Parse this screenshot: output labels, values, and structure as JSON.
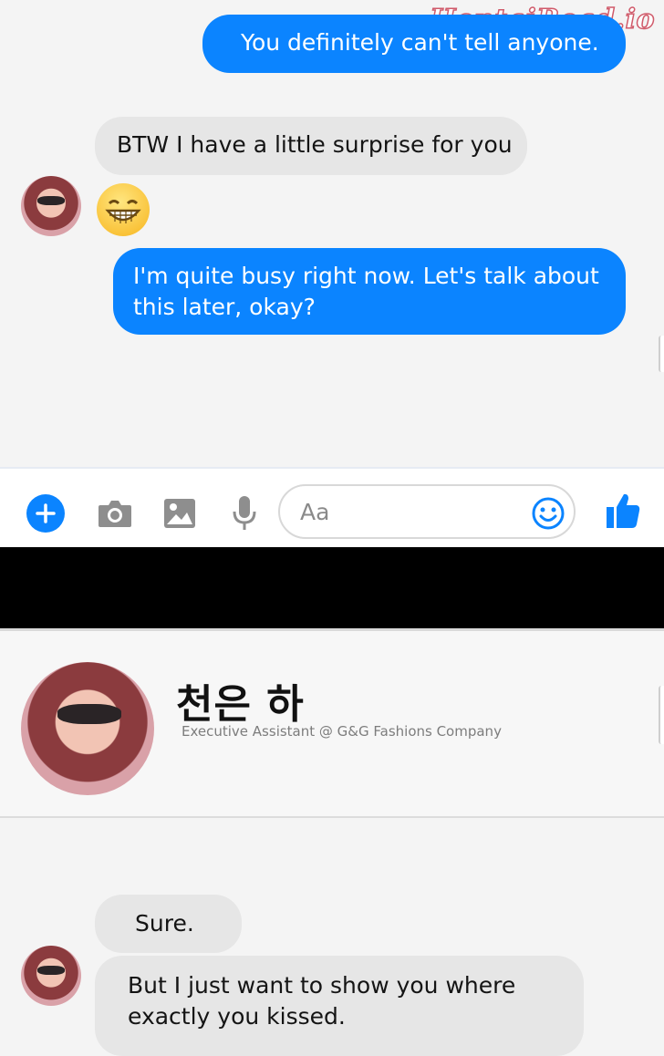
{
  "watermark": "HentaiRead.io",
  "messages_top": [
    {
      "text": "You definitely can't tell anyone."
    },
    {
      "text": "BTW I have a little surprise for you"
    },
    {
      "text": "I'm quite busy right now.  Let's talk about this later, okay?"
    }
  ],
  "composer": {
    "placeholder": "Aa",
    "icons": [
      "plus-icon",
      "camera-icon",
      "image-icon",
      "microphone-icon",
      "smiley-icon",
      "thumbs-up-icon"
    ],
    "accent": "#0b84ff"
  },
  "profile": {
    "name": "천은 하",
    "subtitle": "Executive Assistant @ G&G Fashions Company"
  },
  "messages_bottom": [
    {
      "text": "Sure."
    },
    {
      "text": "But I just want to show you where exactly you kissed."
    }
  ],
  "colors": {
    "outgoing_bubble": "#0b84ff",
    "incoming_bubble": "#e6e6e6",
    "background": "#f4f4f4"
  }
}
